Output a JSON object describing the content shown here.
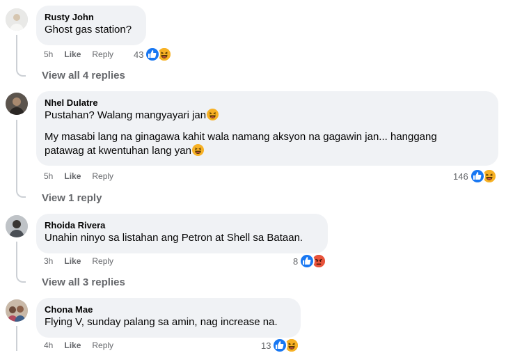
{
  "comments": [
    {
      "author": "Rusty John",
      "texts": [
        "Ghost gas station?"
      ],
      "time": "5h",
      "like_label": "Like",
      "reply_label": "Reply",
      "reaction_count": "43",
      "reactions": [
        "like-icon",
        "haha-icon"
      ],
      "view_replies": "View all 4 replies"
    },
    {
      "author": "Nhel Dulatre",
      "texts": [
        "Pustahan? Walang mangyayari jan",
        "My masabi lang na ginagawa kahit wala namang aksyon na gagawin jan... hanggang",
        "patawag at kwentuhan lang yan"
      ],
      "time": "5h",
      "like_label": "Like",
      "reply_label": "Reply",
      "reaction_count": "146",
      "reactions": [
        "like-icon",
        "haha-icon"
      ],
      "view_replies": "View 1 reply"
    },
    {
      "author": "Rhoida Rivera",
      "texts": [
        "Unahin ninyo sa listahan ang Petron at Shell sa Bataan."
      ],
      "time": "3h",
      "like_label": "Like",
      "reply_label": "Reply",
      "reaction_count": "8",
      "reactions": [
        "like-icon",
        "angry-icon"
      ],
      "view_replies": "View all 3 replies"
    },
    {
      "author": "Chona Mae",
      "texts": [
        "Flying V, sunday palang sa amin, nag increase na."
      ],
      "time": "4h",
      "like_label": "Like",
      "reply_label": "Reply",
      "reaction_count": "13",
      "reactions": [
        "like-icon",
        "haha-icon"
      ]
    }
  ],
  "colors": {
    "bubble": "#f0f2f5",
    "secondary_text": "#65676b",
    "like": "#1877f2",
    "haha": "#f7b125",
    "angry": "#e8533b"
  }
}
